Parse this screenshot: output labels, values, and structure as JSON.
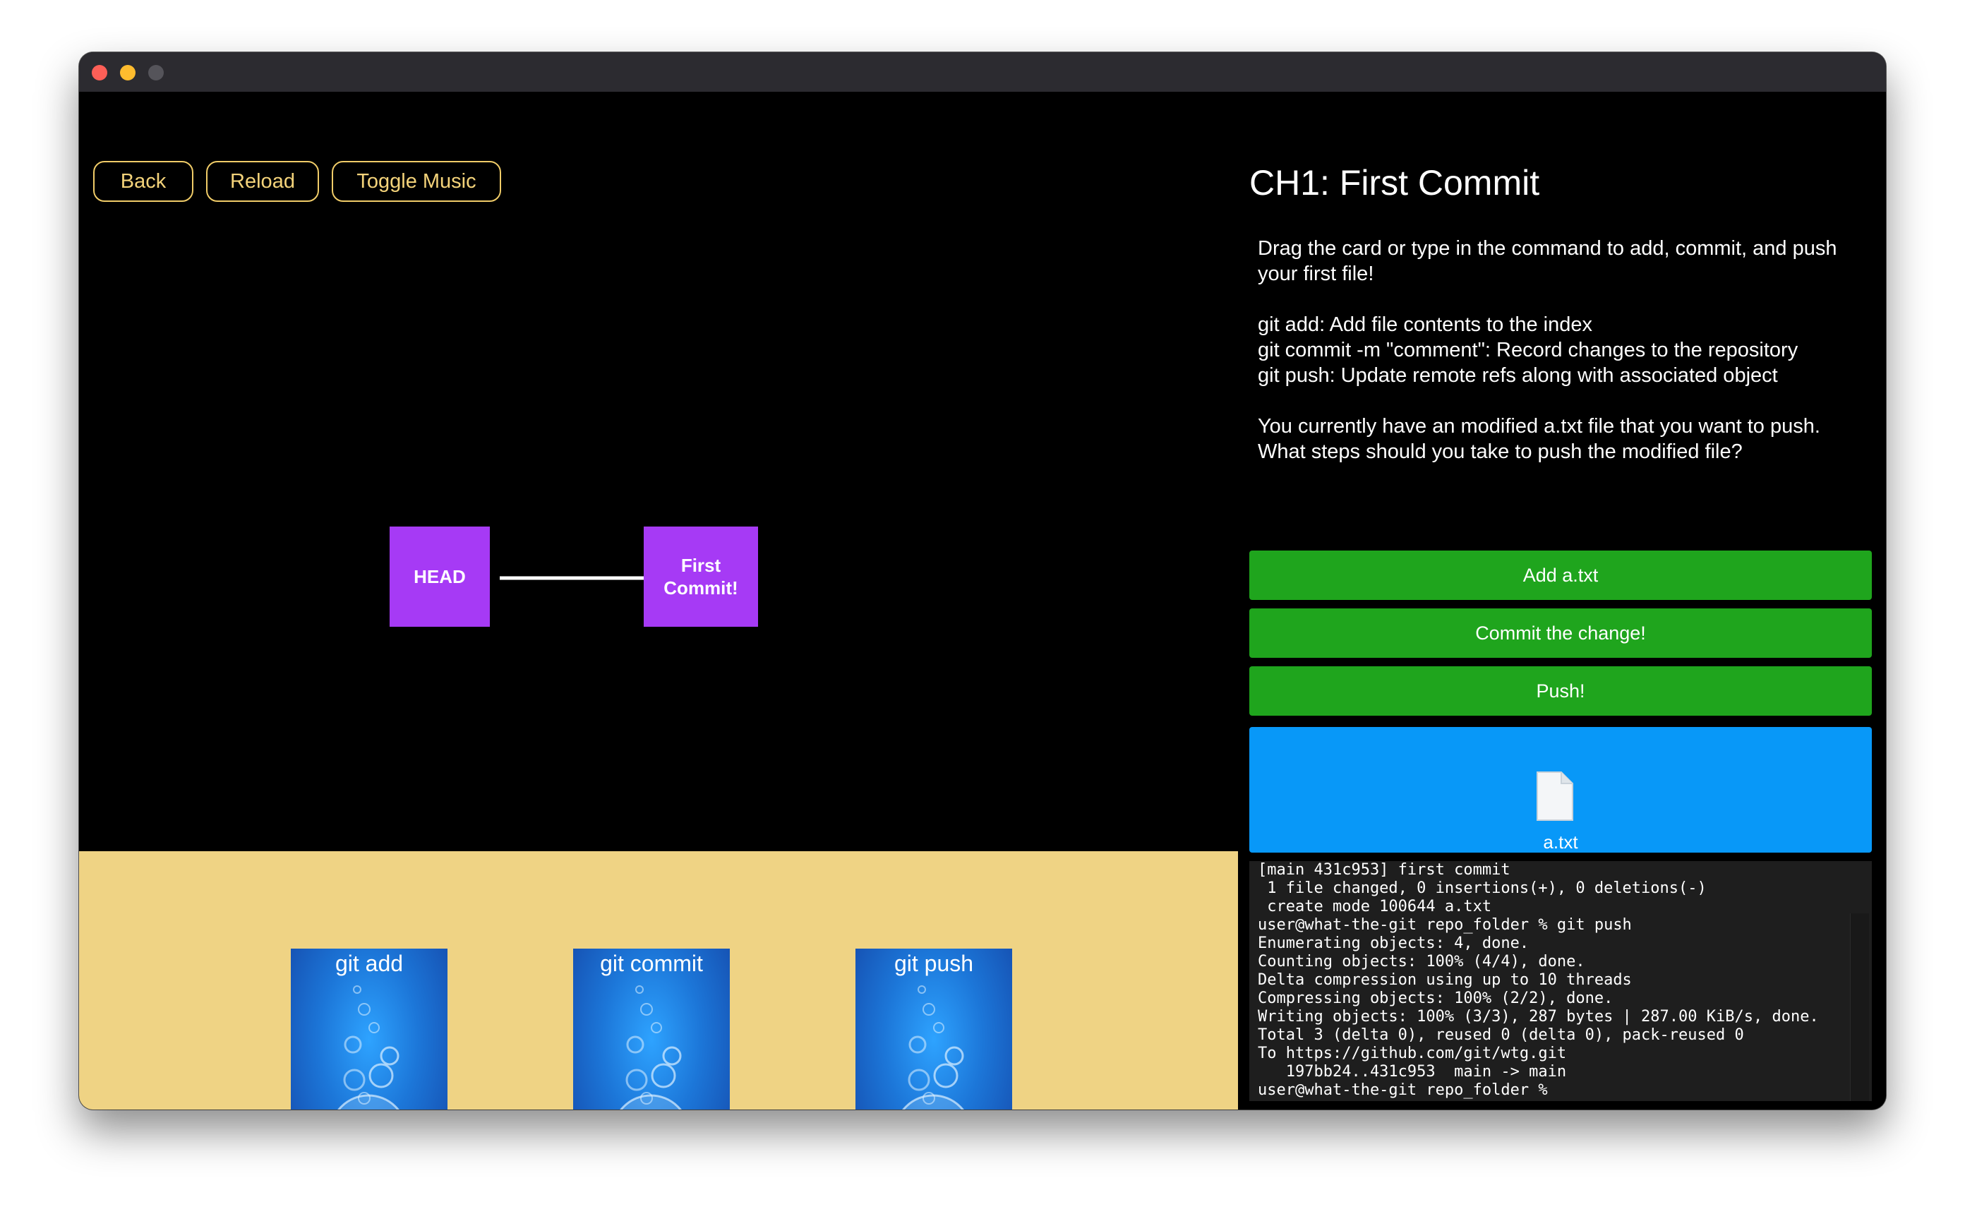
{
  "window": {
    "traffic_lights": [
      "close",
      "minimize",
      "maximize"
    ]
  },
  "toolbar": {
    "back_label": "Back",
    "reload_label": "Reload",
    "toggle_music_label": "Toggle Music"
  },
  "graph": {
    "head_label": "HEAD",
    "commit_label": "First\nCommit!",
    "node_color": "#a63af5"
  },
  "cards": [
    {
      "label": "git add"
    },
    {
      "label": "git commit"
    },
    {
      "label": "git push"
    }
  ],
  "lesson": {
    "title": "CH1: First Commit",
    "intro": "Drag the card or type in the command to add, commit, and push your first file!",
    "commands": [
      "git add: Add file contents to the index",
      "git commit -m \"comment\": Record changes to the repository",
      "git push: Update remote refs along with associated object"
    ],
    "question": "You currently have an modified a.txt file that you want to push. What steps should you take to push the modified file?"
  },
  "actions": {
    "add_label": "Add a.txt",
    "commit_label": "Commit the change!",
    "push_label": "Push!",
    "color": "#1fa51d"
  },
  "file_zone": {
    "icon": "file-icon",
    "file_name": "a.txt",
    "color": "#0898f8"
  },
  "terminal": {
    "lines": [
      "[main 431c953] first commit",
      " 1 file changed, 0 insertions(+), 0 deletions(-)",
      " create mode 100644 a.txt",
      "user@what-the-git repo_folder % git push",
      "Enumerating objects: 4, done.",
      "Counting objects: 100% (4/4), done.",
      "Delta compression using up to 10 threads",
      "Compressing objects: 100% (2/2), done.",
      "Writing objects: 100% (3/3), 287 bytes | 287.00 KiB/s, done.",
      "Total 3 (delta 0), reused 0 (delta 0), pack-reused 0",
      "To https://github.com/git/wtg.git",
      "   197bb24..431c953  main -> main",
      "user@what-the-git repo_folder %"
    ]
  },
  "command_input": {
    "value": "",
    "placeholder": ""
  },
  "colors": {
    "button_border": "#f0cc68",
    "deck_background": "#efd384"
  }
}
